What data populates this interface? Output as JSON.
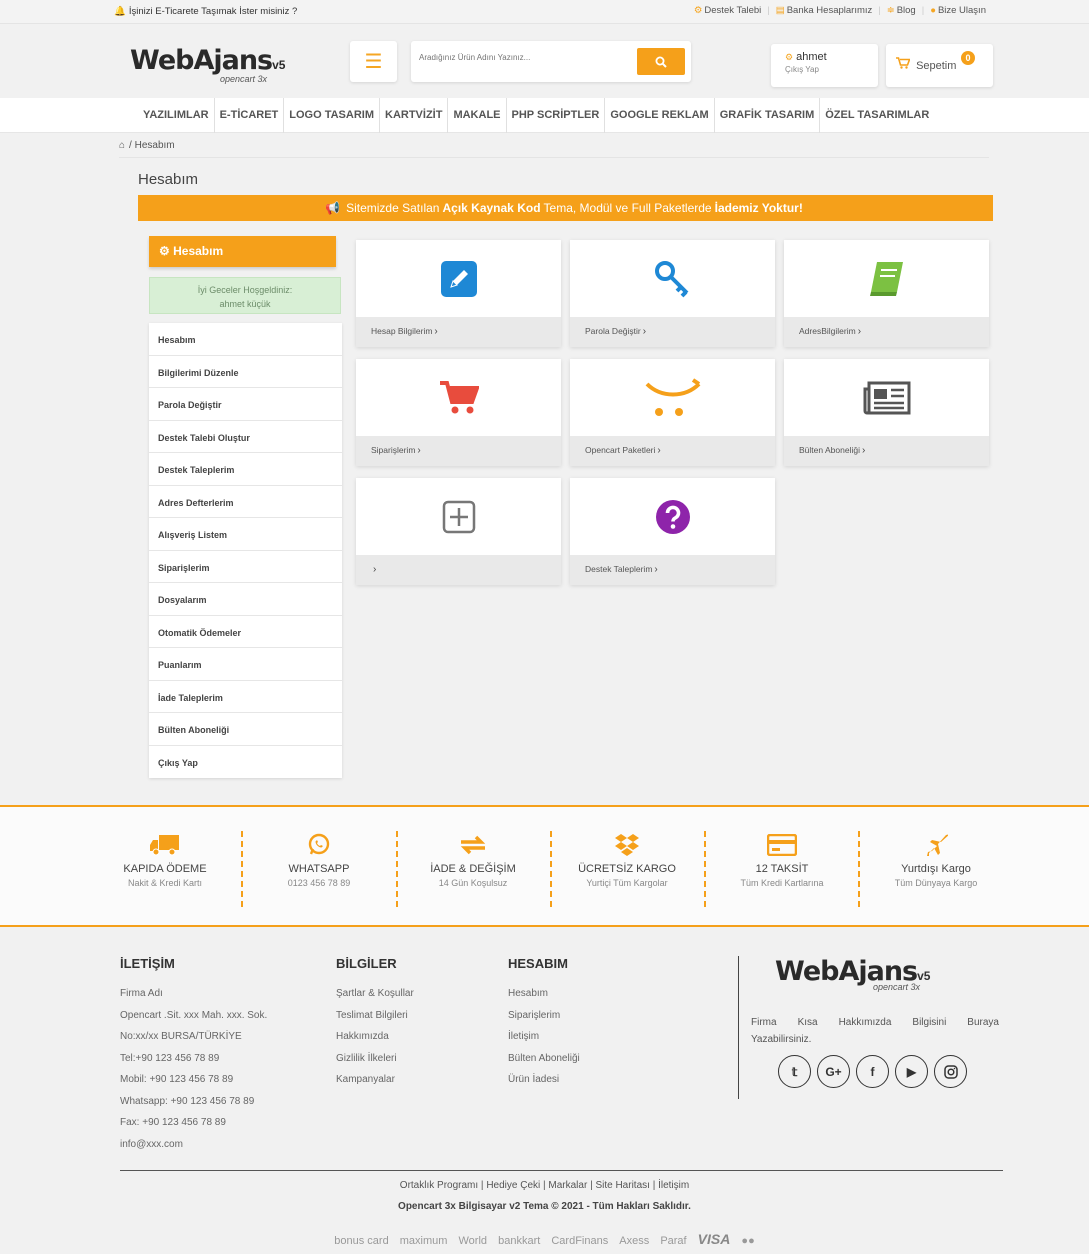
{
  "topbar": {
    "promo": "İşinizi E-Ticarete Taşımak İster misiniz ?",
    "links": [
      "Destek Talebi",
      "Banka Hesaplarımız",
      "Blog",
      "Bize Ulaşın"
    ]
  },
  "header": {
    "logo_main": "WebAjans",
    "logo_version": "v5",
    "logo_sub": "opencart 3x",
    "search_placeholder": "Aradığınız Ürün Adını Yazınız...",
    "account_name": "ahmet",
    "account_logout": "Çıkış Yap",
    "cart_label": "Sepetim",
    "cart_count": "0"
  },
  "nav": [
    "YAZILIMLAR",
    "E-TİCARET",
    "LOGO TASARIM",
    "KARTVİZİT",
    "MAKALE",
    "PHP SCRİPTLER",
    "GOOGLE REKLAM",
    "GRAFİK TASARIM",
    "ÖZEL TASARIMLAR"
  ],
  "breadcrumb": {
    "current": "Hesabım"
  },
  "page_title": "Hesabım",
  "banner": {
    "part1": "Sitemizde Satılan",
    "bold1": "Açık Kaynak Kod",
    "part2": "Tema, Modül ve Full Paketlerde",
    "bold2": "İademiz Yoktur!"
  },
  "sidebar": {
    "title": "Hesabım",
    "welcome_line1": "İyi Geceler Hoşgeldiniz:",
    "welcome_line2": "ahmet küçük",
    "items": [
      "Hesabım",
      "Bilgilerimi Düzenle",
      "Parola Değiştir",
      "Destek Talebi Oluştur",
      "Destek Taleplerim",
      "Adres Defterlerim",
      "Alışveriş Listem",
      "Siparişlerim",
      "Dosyalarım",
      "Otomatik Ödemeler",
      "Puanlarım",
      "İade Taleplerim",
      "Bülten Aboneliği",
      "Çıkış Yap"
    ]
  },
  "tiles": [
    {
      "label": "Hesap Bilgilerim",
      "icon": "edit-icon",
      "color": "#1e88d5"
    },
    {
      "label": "Parola Değiştir",
      "icon": "key-icon",
      "color": "#1e88d5"
    },
    {
      "label": "AdresBilgilerim",
      "icon": "address-book-icon",
      "color": "#7cc142"
    },
    {
      "label": "Siparişlerim",
      "icon": "cart-icon",
      "color": "#e84c3d"
    },
    {
      "label": "Opencart Paketleri",
      "icon": "opencart-icon",
      "color": "#f5a01a"
    },
    {
      "label": "Bülten Aboneliği",
      "icon": "newspaper-icon",
      "color": "#555555"
    },
    {
      "label": "",
      "icon": "plus-square-icon",
      "color": "#777777"
    },
    {
      "label": "Destek Taleplerim",
      "icon": "question-icon",
      "color": "#8e24aa"
    }
  ],
  "features": [
    {
      "title": "KAPIDA ÖDEME",
      "sub": "Nakit & Kredi Kartı",
      "icon": "truck-icon"
    },
    {
      "title": "WHATSAPP",
      "sub": "0123 456 78 89",
      "icon": "whatsapp-icon"
    },
    {
      "title": "İADE & DEĞİŞİM",
      "sub": "14 Gün Koşulsuz",
      "icon": "exchange-icon"
    },
    {
      "title": "ÜCRETSİZ KARGO",
      "sub": "Yurtiçi Tüm Kargolar",
      "icon": "dropbox-icon"
    },
    {
      "title": "12 TAKSİT",
      "sub": "Tüm Kredi Kartlarına",
      "icon": "credit-card-icon"
    },
    {
      "title": "Yurtdışı Kargo",
      "sub": "Tüm Dünyaya Kargo",
      "icon": "plane-icon"
    }
  ],
  "footer": {
    "contact_title": "İLETİŞİM",
    "contact": [
      "Firma Adı",
      "Opencart .Sit. xxx Mah. xxx. Sok.",
      "No:xx/xx BURSA/TÜRKİYE",
      "Tel:+90 123 456 78 89",
      "Mobil: +90 123 456 78 89",
      "Whatsapp: +90 123 456 78 89",
      "Fax: +90 123 456 78 89",
      "info@xxx.com"
    ],
    "info_title": "BİLGİLER",
    "info": [
      "Şartlar & Koşullar",
      "Teslimat Bilgileri",
      "Hakkımızda",
      "Gizlilik İlkeleri",
      "Kampanyalar"
    ],
    "account_title": "HESABIM",
    "account": [
      "Hesabım",
      "Siparişlerim",
      "İletişim",
      "Bülten Aboneliği",
      "Ürün İadesi"
    ],
    "about": "Firma Kısa Hakkımızda Bilgisini Buraya Yazabilirsiniz.",
    "socials": [
      "twitter-icon",
      "google-plus-icon",
      "facebook-icon",
      "youtube-icon",
      "instagram-icon"
    ],
    "bottom_links": [
      "Ortaklık Programı",
      "Hediye Çeki",
      "Markalar",
      "Site Haritası",
      "İletişim"
    ],
    "copyright": "Opencart 3x Bilgisayar v2 Tema © 2021 - Tüm Hakları Saklıdır.",
    "payment_logos": [
      "bonus card",
      "maximum",
      "World",
      "bankkart",
      "CardFinans",
      "Axess",
      "Paraf",
      "VISA"
    ]
  }
}
